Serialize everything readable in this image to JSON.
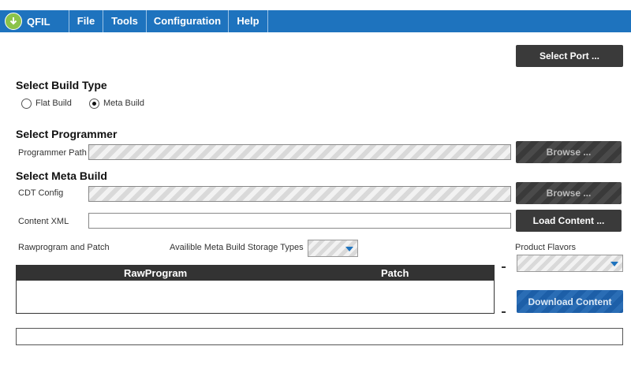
{
  "app": {
    "title": "QFIL"
  },
  "menu": {
    "items": [
      "File",
      "Tools",
      "Configuration",
      "Help"
    ]
  },
  "buttons": {
    "select_port": "Select Port ...",
    "browse_programmer": "Browse ...",
    "browse_cdt": "Browse ...",
    "load_content": "Load Content ...",
    "download_content": "Download Content"
  },
  "build_type": {
    "heading": "Select Build Type",
    "options": [
      "Flat Build",
      "Meta Build"
    ],
    "selected": "Meta Build"
  },
  "programmer": {
    "heading": "Select Programmer",
    "path_label": "Programmer Path",
    "path_value": ""
  },
  "meta_build": {
    "heading": "Select Meta Build",
    "cdt_label": "CDT Config",
    "cdt_value": "",
    "content_xml_label": "Content XML",
    "content_xml_value": ""
  },
  "rawprogram": {
    "label": "Rawprogram and Patch",
    "storage_label": "Availible Meta Build Storage Types",
    "storage_value": "",
    "columns": [
      "RawProgram",
      "Patch"
    ],
    "rows": []
  },
  "product_flavors": {
    "label": "Product Flavors",
    "value": ""
  },
  "status": {
    "text": ""
  },
  "colors": {
    "menubar": "#1e73be",
    "button_dark": "#3a3a3a",
    "button_blue": "#1d5fa8"
  }
}
